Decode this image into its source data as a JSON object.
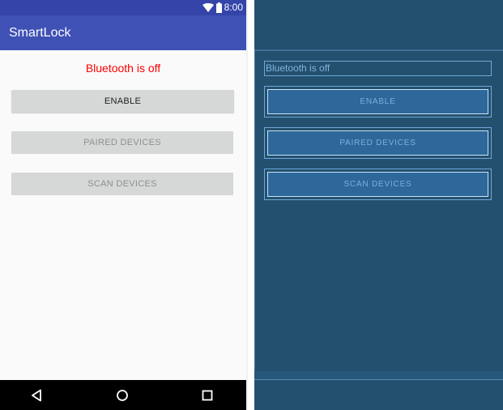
{
  "device": {
    "status_bar": {
      "time": "8:00",
      "icons": [
        "wifi-icon",
        "battery-icon"
      ]
    },
    "app_bar": {
      "title": "SmartLock"
    },
    "content": {
      "status_text": "Bluetooth is off",
      "buttons": {
        "enable": "ENABLE",
        "paired": "PAIRED DEVICES",
        "scan": "SCAN DEVICES"
      }
    },
    "nav_bar": {
      "icons": [
        "back-icon",
        "home-icon",
        "recents-icon"
      ]
    }
  },
  "blueprint": {
    "status_text": "Bluetooth is off",
    "buttons": {
      "enable": "ENABLE",
      "paired": "PAIRED DEVICES",
      "scan": "SCAN DEVICES"
    }
  },
  "colors": {
    "status_bar": "#3444a8",
    "app_bar": "#3f51b5",
    "status_text": "#ff0000",
    "button_bg": "#d6d7d7",
    "blueprint_bg": "#24506f",
    "blueprint_outline": "#6fa8d6"
  }
}
